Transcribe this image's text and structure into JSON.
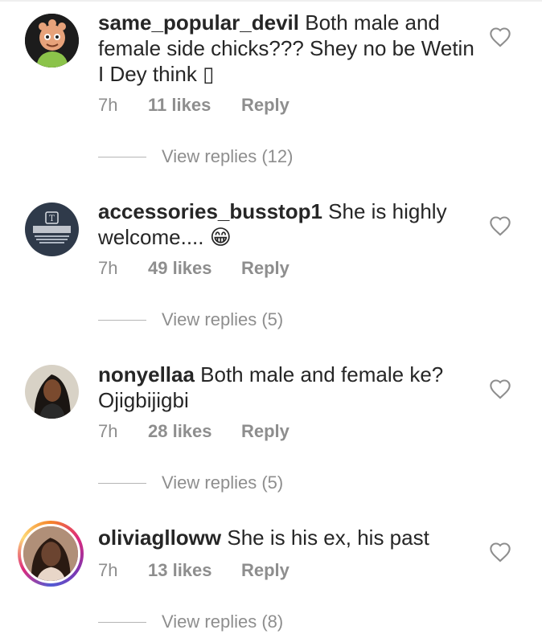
{
  "comments": [
    {
      "username": "same_popular_devil",
      "text": " Both male and female side chicks??? Shey no be Wetin I Dey  think ▯",
      "time": "7h",
      "likes": "11 likes",
      "reply_label": "Reply",
      "view_replies": "View replies (12)",
      "avatar_icon": "cartoon-avatar",
      "heart_icon": "heart-outline"
    },
    {
      "username": "accessories_busstop1",
      "text": " She is highly welcome.... 😁",
      "time": "7h",
      "likes": "49 likes",
      "reply_label": "Reply",
      "view_replies": "View replies (5)",
      "avatar_icon": "logo-avatar",
      "heart_icon": "heart-outline"
    },
    {
      "username": "nonyellaa",
      "text": " Both male and female ke? Ojigbijigbi",
      "time": "7h",
      "likes": "28 likes",
      "reply_label": "Reply",
      "view_replies": "View replies (5)",
      "avatar_icon": "photo-avatar",
      "heart_icon": "heart-outline"
    },
    {
      "username": "oliviaglloww",
      "text": " She is his ex, his past",
      "time": "7h",
      "likes": "13 likes",
      "reply_label": "Reply",
      "view_replies": "View replies (8)",
      "avatar_icon": "photo-avatar-story-ring",
      "heart_icon": "heart-outline"
    }
  ],
  "colors": {
    "text_primary": "#262626",
    "text_secondary": "#8e8e8e",
    "divider": "#b5b5b5"
  }
}
